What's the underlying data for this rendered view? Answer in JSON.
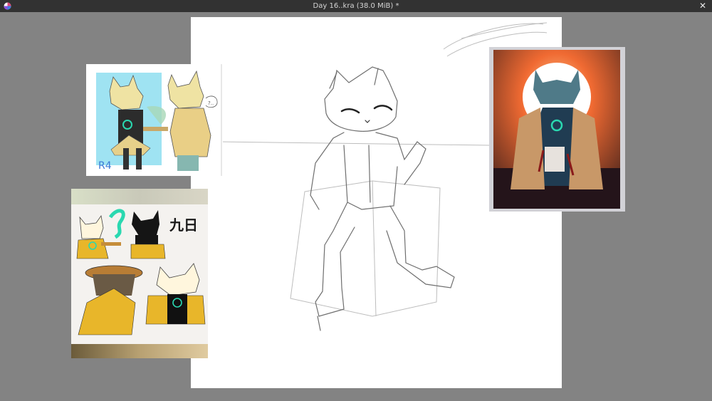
{
  "window": {
    "title": "Day 16..kra (38.0 MiB) *",
    "app_icon": "krita-logo-icon",
    "close_label": "✕"
  },
  "canvas": {
    "background": "#ffffff"
  },
  "references": [
    {
      "name": "reference-sketch-cat-trumpet",
      "text": "R4"
    },
    {
      "name": "reference-character-sheet",
      "text": "九日"
    },
    {
      "name": "reference-moon-painting"
    }
  ],
  "colors": {
    "window_bg": "#838383",
    "titlebar_bg": "#323232",
    "accent_yellow": "#e8b62a",
    "accent_teal": "#2ad8b0",
    "sunset_orange": "#f06a32"
  }
}
